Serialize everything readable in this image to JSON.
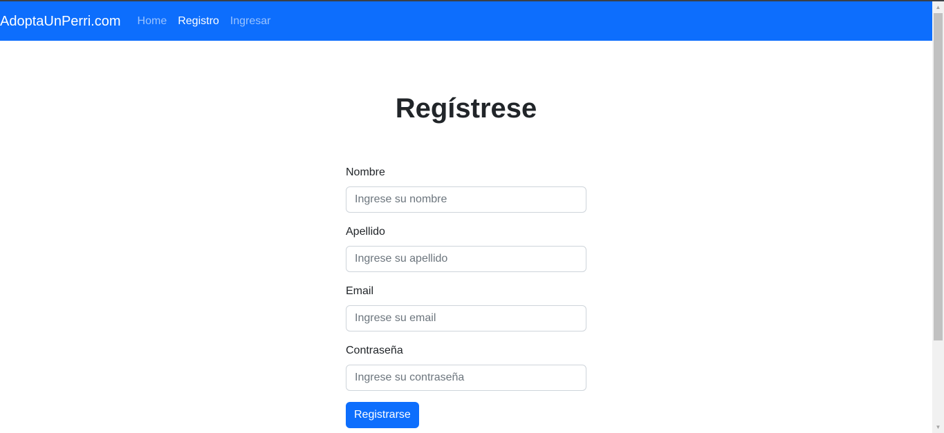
{
  "navbar": {
    "brand": "AdoptaUnPerri.com",
    "links": [
      {
        "label": "Home",
        "active": false
      },
      {
        "label": "Registro",
        "active": true
      },
      {
        "label": "Ingresar",
        "active": false
      }
    ],
    "background": "#0d6efd"
  },
  "page": {
    "title": "Regístrese"
  },
  "form": {
    "nombre": {
      "label": "Nombre",
      "placeholder": "Ingrese su nombre",
      "value": ""
    },
    "apellido": {
      "label": "Apellido",
      "placeholder": "Ingrese su apellido",
      "value": ""
    },
    "email": {
      "label": "Email",
      "placeholder": "Ingrese su email",
      "value": ""
    },
    "password": {
      "label": "Contraseña",
      "placeholder": "Ingrese su contraseña",
      "value": ""
    },
    "submit_label": "Registrarse",
    "accent": "#0d6efd"
  },
  "scrollbar": {
    "up_icon": "scroll-up-arrow",
    "down_icon": "scroll-down-arrow"
  }
}
